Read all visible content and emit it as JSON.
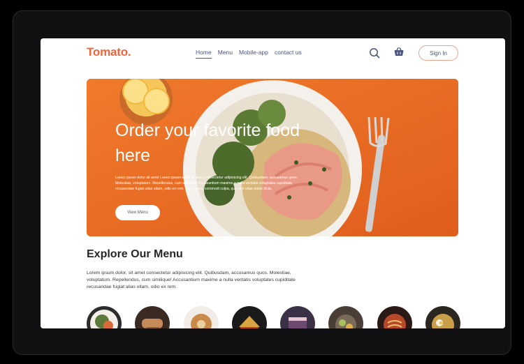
{
  "brand": {
    "logo": "Tomato.",
    "color": "#f0643a"
  },
  "nav": {
    "items": [
      {
        "label": "Home",
        "active": true
      },
      {
        "label": "Menu"
      },
      {
        "label": "Mobile-app"
      },
      {
        "label": "contact us"
      }
    ],
    "icons": [
      "search-icon",
      "basket-icon"
    ],
    "sign_in_label": "Sign In"
  },
  "hero": {
    "title": "Order your favorite food here",
    "text": "Lorem ipsum dolor sit amet Lorem ipsum dolor sit amet consectetur adipisicing elit. Quibusdam, accusamus quos. Molestiae, voluptatum. Repellendus, cum similique! Accusantium maxime a nulla veritatis voluptates cupiditate recusandae fugiat alias ullam, odio ex rem. Experiores, commodi culpa, quo rem vitae nobis dicta.",
    "button_label": "View Menu",
    "background": "#ef6d27"
  },
  "explore": {
    "title": "Explore Our Menu",
    "text": "Lorem ipsum dolor, sit amet consectetur adipisicing elit. Quibusdam, accusamus quos. Molestiae, voluptatum. Repellendus, cum similique! Accusantium maxime a nulla veritatis voluptates cupiditate recusandae fugiat alias ullam, odio ex rem."
  },
  "menu_categories": [
    {
      "icon": "salad-dish-icon",
      "color": "#5c7a3a"
    },
    {
      "icon": "rolls-dish-icon",
      "color": "#8a5a3c"
    },
    {
      "icon": "deserts-dish-icon",
      "color": "#c98a4a"
    },
    {
      "icon": "sandwich-dish-icon",
      "color": "#d9a441"
    },
    {
      "icon": "cake-dish-icon",
      "color": "#6b4a6e"
    },
    {
      "icon": "pure-veg-dish-icon",
      "color": "#7a6a5a"
    },
    {
      "icon": "pasta-dish-icon",
      "color": "#b8482a"
    },
    {
      "icon": "noodles-dish-icon",
      "color": "#c9a04a"
    }
  ]
}
